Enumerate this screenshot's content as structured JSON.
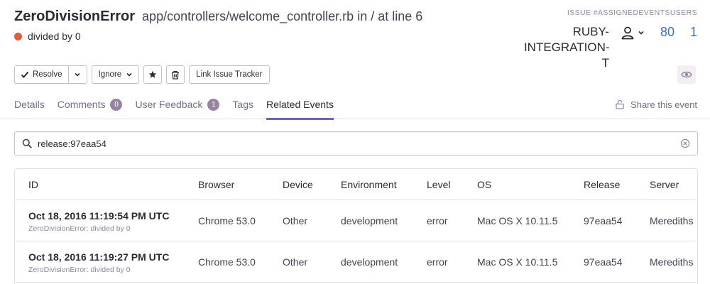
{
  "issue": {
    "error_type": "ZeroDivisionError",
    "culprit": "app/controllers/welcome_controller.rb in / at line 6",
    "message": "divided by 0",
    "short_id_label": "Issue #ASSIGNEDEVENTSUSERS",
    "project_name": "RUBY-INTEGRATION-T",
    "events_count": "80",
    "users_count": "1"
  },
  "colors": {
    "level_error": "#e55a3e",
    "accent": "#6c5fc7",
    "link": "#3b6ecc"
  },
  "actions": {
    "resolve": "Resolve",
    "ignore": "Ignore",
    "link_issue_tracker": "Link Issue Tracker"
  },
  "tabs": [
    {
      "label": "Details",
      "badge": ""
    },
    {
      "label": "Comments",
      "badge": "0"
    },
    {
      "label": "User Feedback",
      "badge": "1"
    },
    {
      "label": "Tags",
      "badge": ""
    },
    {
      "label": "Related Events",
      "badge": ""
    }
  ],
  "share_label": "Share this event",
  "search": {
    "query": "release:97eaa54"
  },
  "table": {
    "columns": [
      "ID",
      "Browser",
      "Device",
      "Environment",
      "Level",
      "OS",
      "Release",
      "Server"
    ],
    "rows": [
      {
        "date": "Oct 18, 2016 11:19:54 PM UTC",
        "summary": "ZeroDivisionError: divided by 0",
        "browser": "Chrome 53.0",
        "device": "Other",
        "environment": "development",
        "level": "error",
        "os": "Mac OS X 10.11.5",
        "release": "97eaa54",
        "server": "Merediths"
      },
      {
        "date": "Oct 18, 2016 11:19:27 PM UTC",
        "summary": "ZeroDivisionError: divided by 0",
        "browser": "Chrome 53.0",
        "device": "Other",
        "environment": "development",
        "level": "error",
        "os": "Mac OS X 10.11.5",
        "release": "97eaa54",
        "server": "Merediths"
      }
    ]
  }
}
